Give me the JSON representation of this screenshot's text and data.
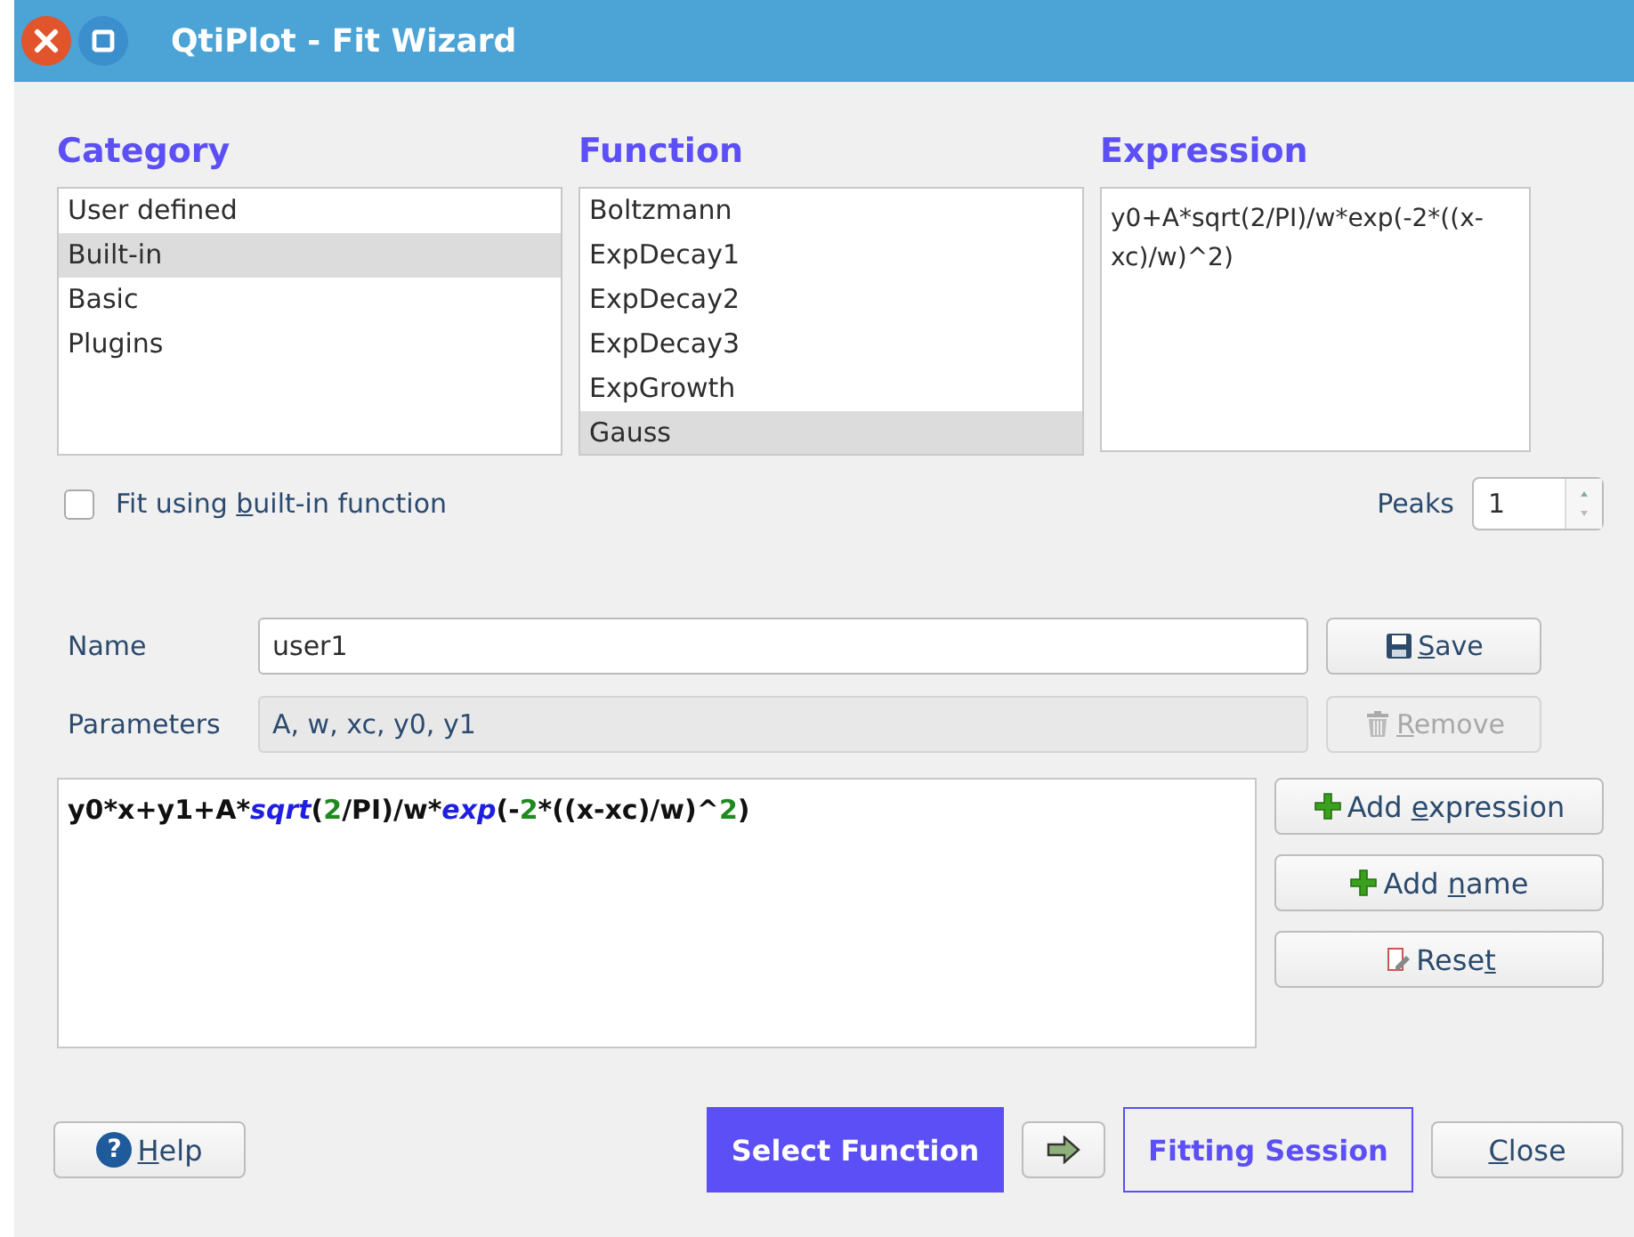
{
  "window": {
    "title": "QtiPlot - Fit Wizard"
  },
  "category": {
    "heading": "Category",
    "items": [
      {
        "label": "User defined",
        "selected": false
      },
      {
        "label": "Built-in",
        "selected": true
      },
      {
        "label": "Basic",
        "selected": false
      },
      {
        "label": "Plugins",
        "selected": false
      }
    ]
  },
  "function": {
    "heading": "Function",
    "items": [
      {
        "label": "Boltzmann",
        "selected": false
      },
      {
        "label": "ExpDecay1",
        "selected": false
      },
      {
        "label": "ExpDecay2",
        "selected": false
      },
      {
        "label": "ExpDecay3",
        "selected": false
      },
      {
        "label": "ExpGrowth",
        "selected": false
      },
      {
        "label": "Gauss",
        "selected": true
      }
    ]
  },
  "expression": {
    "heading": "Expression",
    "text": "y0+A*sqrt(2/PI)/w*exp(-2*((x-xc)/w)^2)"
  },
  "fit_builtin": {
    "label_parts": {
      "pre": "Fit using ",
      "key": "b",
      "post": "uilt-in function"
    },
    "checked": false
  },
  "peaks": {
    "label": "Peaks",
    "value": "1"
  },
  "name": {
    "label": "Name",
    "value": "user1"
  },
  "parameters": {
    "label": "Parameters",
    "value": "A, w, xc, y0, y1"
  },
  "save_button": {
    "label_parts": {
      "key": "S",
      "post": "ave"
    },
    "disabled": false
  },
  "remove_button": {
    "label_parts": {
      "key": "R",
      "post": "emove"
    },
    "disabled": true
  },
  "formula": [
    {
      "kind": "text",
      "text": "y0*x+y1+A*"
    },
    {
      "kind": "func",
      "text": "sqrt"
    },
    {
      "kind": "text",
      "text": "("
    },
    {
      "kind": "num",
      "text": "2"
    },
    {
      "kind": "text",
      "text": "/PI)/w*"
    },
    {
      "kind": "func",
      "text": "exp"
    },
    {
      "kind": "text",
      "text": "(-"
    },
    {
      "kind": "num",
      "text": "2"
    },
    {
      "kind": "text",
      "text": "*((x-xc)/w)^"
    },
    {
      "kind": "num",
      "text": "2"
    },
    {
      "kind": "text",
      "text": ")"
    }
  ],
  "side_buttons": [
    {
      "kind": "plus",
      "label_parts": {
        "pre": "Add ",
        "key": "e",
        "post": "xpression"
      }
    },
    {
      "kind": "plus",
      "label_parts": {
        "pre": "Add ",
        "key": "n",
        "post": "ame"
      }
    },
    {
      "kind": "reset",
      "label_parts": {
        "pre": "Rese",
        "key": "t"
      }
    }
  ],
  "help_button": {
    "icon": "?",
    "label_parts": {
      "key": "H",
      "post": "elp"
    }
  },
  "steps": [
    {
      "label": "Select Function",
      "selected": true
    },
    {
      "label": "Fitting Session",
      "selected": false
    }
  ],
  "close_button": {
    "label_parts": {
      "key": "C",
      "post": "lose"
    }
  }
}
